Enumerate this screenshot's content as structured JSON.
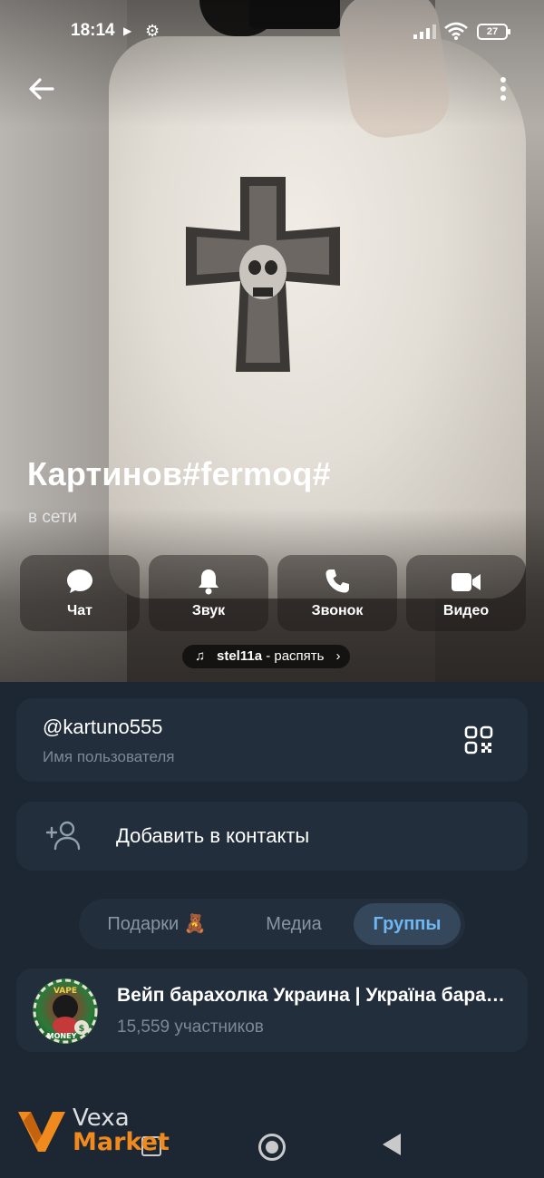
{
  "status_bar": {
    "time": "18:14",
    "battery": "27"
  },
  "profile": {
    "name": "Картинов#fermoq#",
    "presence": "в сети"
  },
  "actions": [
    {
      "label": "Чат",
      "icon": "chat-bubble-icon"
    },
    {
      "label": "Звук",
      "icon": "bell-icon"
    },
    {
      "label": "Звонок",
      "icon": "phone-icon"
    },
    {
      "label": "Видео",
      "icon": "video-camera-icon"
    }
  ],
  "music": {
    "note_icon": "♫",
    "artist": "stel11a",
    "action": " - распять ",
    "chevron": "›"
  },
  "username_card": {
    "username": "@kartuno555",
    "label": "Имя пользователя",
    "icon": "qr-code-icon"
  },
  "add_contact": {
    "label": "Добавить в контакты",
    "icon": "add-person-icon"
  },
  "tabs": [
    {
      "label": "Подарки 🧸",
      "active": false
    },
    {
      "label": "Медиа",
      "active": false
    },
    {
      "label": "Группы",
      "active": true
    }
  ],
  "group": {
    "title": "Вейп барахолка Украина | Україна барахолка",
    "subtitle": "15,559 участников",
    "avatar_text_top": "VAPE",
    "avatar_text_bottom": "MONEY"
  },
  "watermark": {
    "line1": "Vexa",
    "line2": "Market"
  },
  "colors": {
    "background": "#1c2733",
    "card": "#232e3c",
    "accent": "#6fb7f3",
    "secondary_text": "#7b8996",
    "watermark_orange": "#f08a1e"
  }
}
